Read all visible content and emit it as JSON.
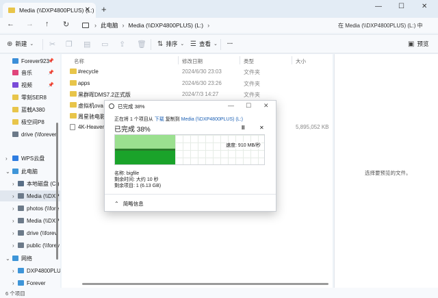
{
  "titlebar": {
    "tab_title": "Media (\\\\DXP4800PLUS) (L:)",
    "tab_close": "✕",
    "new_tab": "+",
    "minimize": "—",
    "maximize": "☐",
    "close": "✕"
  },
  "addressbar": {
    "back": "←",
    "forward": "→",
    "up": "↑",
    "refresh": "↻",
    "crumbs": [
      "此电脑",
      "Media (\\\\DXP4800PLUS) (L:)"
    ],
    "sep": "›",
    "search_placeholder": "在 Media (\\\\DXP4800PLUS) (L:) 中"
  },
  "toolbar": {
    "new_label": "新建",
    "sort_label": "排序",
    "view_label": "查看",
    "more": "···",
    "details_label": "预览"
  },
  "sidebar": {
    "items": [
      {
        "label": "Forever923",
        "pinned": true
      },
      {
        "label": "音乐",
        "pinned": true
      },
      {
        "label": "视频",
        "pinned": true
      },
      {
        "label": "零刻SER8"
      },
      {
        "label": "蓝戟A380"
      },
      {
        "label": "极空间P8"
      },
      {
        "label": "drive (\\\\forever"
      },
      {
        "label": "WPS云盘"
      },
      {
        "label": "此电脑"
      },
      {
        "label": "本地磁盘 (C:)"
      },
      {
        "label": "Media (\\\\DXP"
      },
      {
        "label": "photos (\\\\fore"
      },
      {
        "label": "Media (\\\\DXP"
      },
      {
        "label": "drive (\\\\forev"
      },
      {
        "label": "public (\\\\forev"
      },
      {
        "label": "网络"
      },
      {
        "label": "DXP4800PLUS"
      },
      {
        "label": "Forever"
      }
    ]
  },
  "filelist": {
    "headers": {
      "name": "名称",
      "date": "修改日期",
      "type": "类型",
      "size": "大小"
    },
    "rows": [
      {
        "name": "#recycle",
        "date": "2024/6/30 23:03",
        "type": "文件夹",
        "size": ""
      },
      {
        "name": "apps",
        "date": "2024/6/30 23:26",
        "type": "文件夹",
        "size": ""
      },
      {
        "name": "黑群晖DMS7.2正式版",
        "date": "2024/7/3 14:27",
        "type": "文件夹",
        "size": ""
      },
      {
        "name": "虚拟机ova",
        "date": "",
        "type": "",
        "size": ""
      },
      {
        "name": "周星驰电影集",
        "date": "",
        "type": "",
        "size": ""
      },
      {
        "name": "4K-Heaven o",
        "date": "",
        "type": "",
        "size": "5,895,052 KB"
      }
    ]
  },
  "preview": {
    "message": "选择要预览的文件。"
  },
  "status": {
    "count": "6 个项目"
  },
  "dialog": {
    "title": "已完成 38%",
    "info_prefix": "正在将 1 个项目从",
    "info_src": "下载",
    "info_mid": "复制到",
    "info_dst": "Media (\\\\DXP4800PLUS) (L:)",
    "percent_label": "已完成 38%",
    "progress": 0.38,
    "pause": "II",
    "cancel": "✕",
    "speed": "速度: 910 MB/秒",
    "name_line": "名称: bigfile",
    "time_line": "剩余时间: 大约 10 秒",
    "items_line": "剩余项目: 1 (6.13 GB)",
    "details_label": "简略信息",
    "minimize": "—",
    "maximize": "☐",
    "close": "✕"
  },
  "colors": {
    "accent": "#1a5fb4",
    "progress_light": "#9be08f",
    "progress_dark": "#1aa32a",
    "folder": "#e8c54a"
  }
}
